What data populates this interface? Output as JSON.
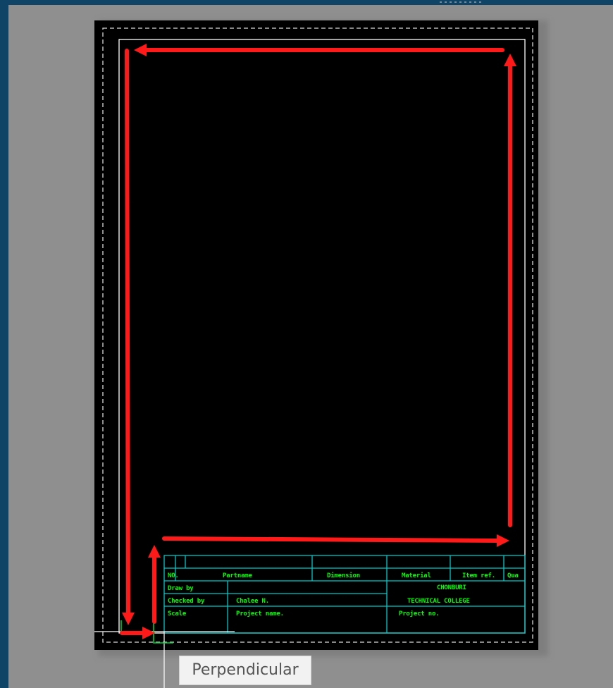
{
  "title_block": {
    "header": {
      "no": "NO.",
      "partname": "Partname",
      "dimension": "Dimension",
      "material": "Material",
      "item_ref": "Item ref.",
      "qty": "Qua"
    },
    "draw_by_label": "Draw by",
    "checked_by_label": "Checked by",
    "checked_by_value": "Chalee  N.",
    "scale_label": "Scale",
    "project_name_label": "Project name.",
    "project_no_label": "Project no.",
    "school_line1": "CHONBURI",
    "school_line2": "TECHNICAL  COLLEGE"
  },
  "tooltip": {
    "text": "Perpendicular"
  },
  "colors": {
    "background": "#0f4466",
    "model_space": "#8f8f8f",
    "paper": "#000000",
    "border_line": "#ffffff",
    "title_block_lines": "#00c8c8",
    "title_block_text": "#00ff00",
    "annotation_arrows": "#ff0000"
  },
  "icons": {
    "snap_marker": "perpendicular-snap-icon",
    "arrows": "red-arrow-icon"
  }
}
